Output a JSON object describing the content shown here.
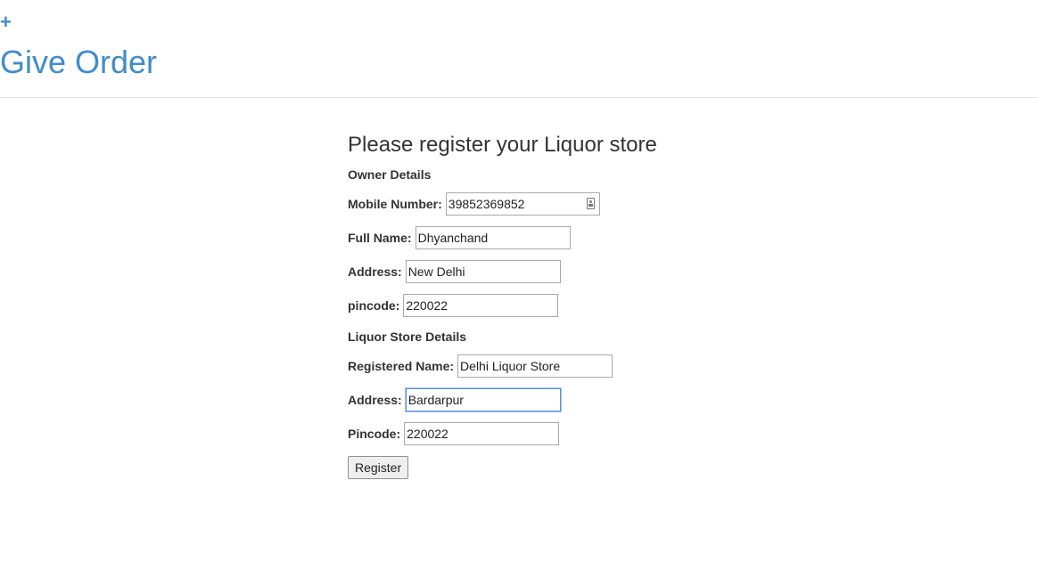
{
  "header": {
    "plus_icon": "+",
    "title": "Give Order"
  },
  "form": {
    "heading": "Please register your Liquor store",
    "owner_section": "Owner Details",
    "store_section": "Liquor Store Details",
    "owner": {
      "mobile_label": "Mobile Number:",
      "mobile_value": "39852369852",
      "name_label": "Full Name:",
      "name_value": "Dhyanchand",
      "address_label": "Address:",
      "address_value": "New Delhi",
      "pincode_label": "pincode:",
      "pincode_value": "220022"
    },
    "store": {
      "name_label": "Registered Name:",
      "name_value": "Delhi Liquor Store",
      "address_label": "Address:",
      "address_value": "Bardarpur",
      "pincode_label": "Pincode:",
      "pincode_value": "220022"
    },
    "register_label": "Register"
  },
  "icons": {
    "add": "plus-icon",
    "contact": "contact-card-icon"
  },
  "colors": {
    "link_blue": "#428bca",
    "focus_border": "#5b8fd8"
  }
}
